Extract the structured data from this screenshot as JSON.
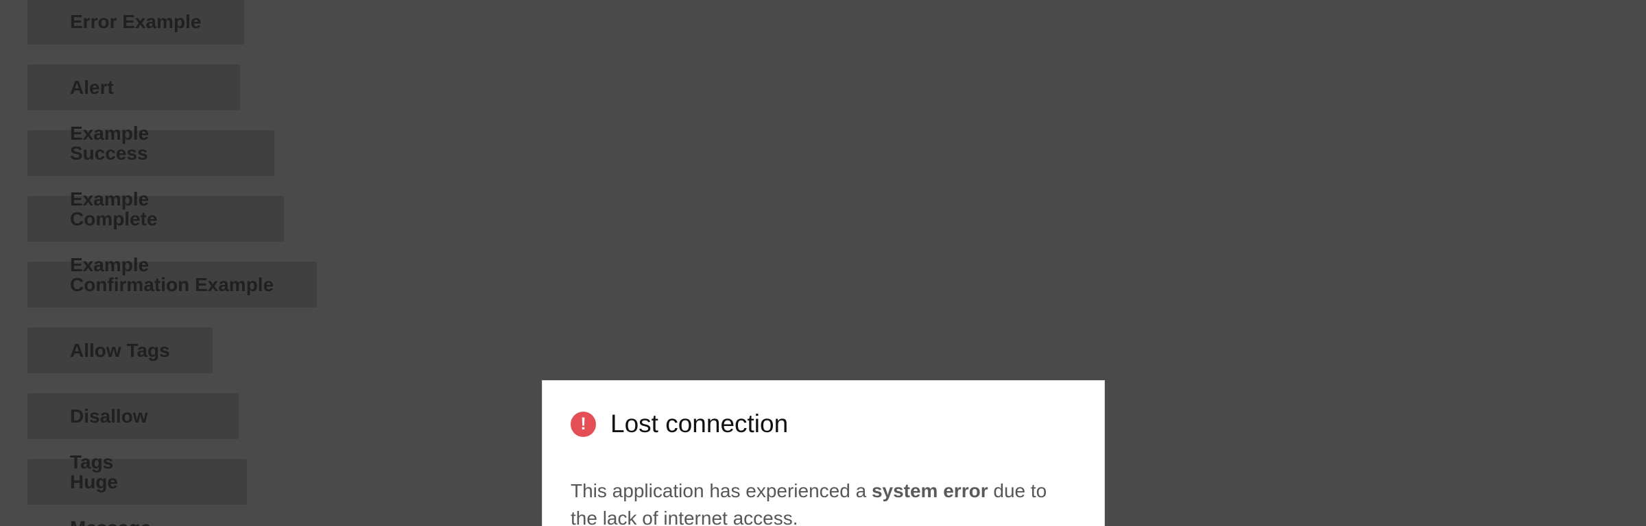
{
  "background_buttons": [
    {
      "label": "Error Example"
    },
    {
      "label": "Alert Example"
    },
    {
      "label": "Success Example"
    },
    {
      "label": "Complete Example"
    },
    {
      "label": "Confirmation Example"
    },
    {
      "label": "Allow Tags"
    },
    {
      "label": "Disallow Tags"
    },
    {
      "label": "Huge Message"
    }
  ],
  "modal": {
    "icon": "error-exclamation-icon",
    "icon_glyph": "!",
    "title": "Lost connection",
    "message_before": "This application has experienced a ",
    "message_bold": "system error",
    "message_after": " due to the lack of internet access."
  },
  "colors": {
    "overlay_background": "#4a4a4a",
    "button_background": "#404040",
    "button_text": "#202020",
    "modal_background": "#ffffff",
    "error_icon": "#e34f55"
  }
}
